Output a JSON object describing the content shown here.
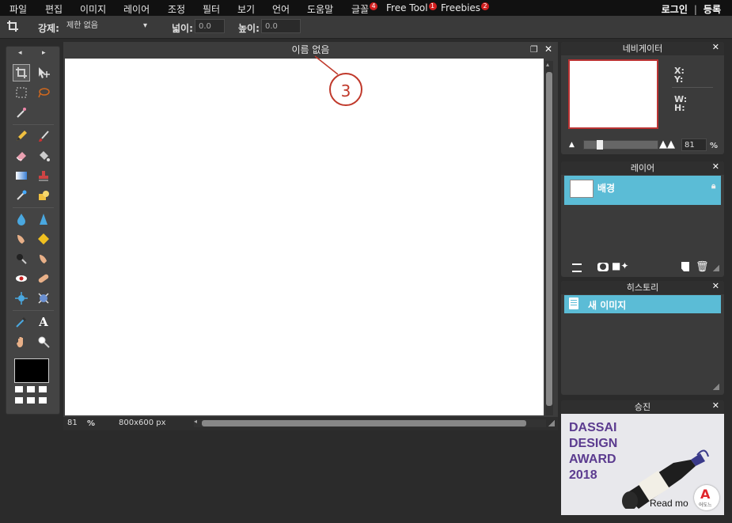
{
  "menubar": {
    "items": [
      {
        "label": "파일"
      },
      {
        "label": "편집"
      },
      {
        "label": "이미지"
      },
      {
        "label": "레이어"
      },
      {
        "label": "조정"
      },
      {
        "label": "필터"
      },
      {
        "label": "보기"
      },
      {
        "label": "언어"
      },
      {
        "label": "도움말"
      },
      {
        "label": "글꼴",
        "badge": "4"
      },
      {
        "label": "Free Tool",
        "badge": "1"
      },
      {
        "label": "Freebies",
        "badge": "2"
      }
    ],
    "login": "로그인",
    "separator": "|",
    "register": "등록"
  },
  "optbar": {
    "constraint_label": "강제:",
    "constraint_value": "제한 없음",
    "width_label": "넓이:",
    "width_value": "0.0",
    "height_label": "높이:",
    "height_value": "0.0"
  },
  "document": {
    "title": "이름 없음",
    "zoom": "81",
    "zoom_unit": "%",
    "size": "800x600 px"
  },
  "callout": {
    "number": "3"
  },
  "navigator": {
    "title": "네비게이터",
    "x_label": "X:",
    "y_label": "Y:",
    "w_label": "W:",
    "h_label": "H:",
    "zoom": "81",
    "zoom_unit": "%"
  },
  "layers": {
    "title": "레이어",
    "items": [
      {
        "name": "배경"
      }
    ]
  },
  "history": {
    "title": "히스토리",
    "items": [
      {
        "name": "새 이미지"
      }
    ]
  },
  "ad": {
    "title": "승진",
    "line1": "DASSAI",
    "line2": "DESIGN",
    "line3": "AWARD",
    "line4": "2018",
    "read_more": "Read mo",
    "logo_text": "어도느"
  },
  "colors": {
    "accent": "#5bbcd6",
    "badge": "#d21f1f",
    "callout": "#c0392b"
  }
}
